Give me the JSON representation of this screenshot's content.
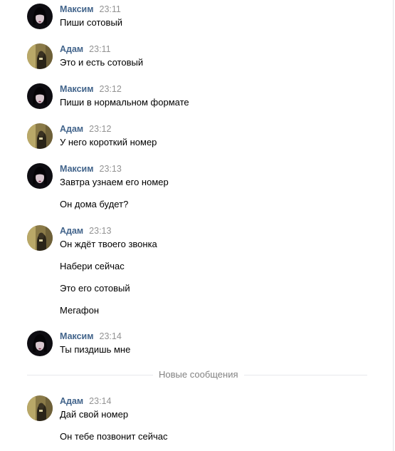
{
  "messages": [
    {
      "author": "Максим",
      "time": "23:11",
      "avatar": "maksim",
      "lines": [
        "Пиши сотовый"
      ]
    },
    {
      "author": "Адам",
      "time": "23:11",
      "avatar": "adam",
      "lines": [
        "Это и есть сотовый"
      ]
    },
    {
      "author": "Максим",
      "time": "23:12",
      "avatar": "maksim",
      "lines": [
        "Пиши в нормальном формате"
      ]
    },
    {
      "author": "Адам",
      "time": "23:12",
      "avatar": "adam",
      "lines": [
        "У него короткий номер"
      ]
    },
    {
      "author": "Максим",
      "time": "23:13",
      "avatar": "maksim",
      "lines": [
        "Завтра узнаем его номер",
        "Он дома будет?"
      ]
    },
    {
      "author": "Адам",
      "time": "23:13",
      "avatar": "adam",
      "lines": [
        "Он ждёт твоего звонка",
        "Набери сейчас",
        "Это его сотовый",
        "Мегафон"
      ]
    },
    {
      "author": "Максим",
      "time": "23:14",
      "avatar": "maksim",
      "lines": [
        "Ты пиздишь мне"
      ]
    },
    {
      "author": "Адам",
      "time": "23:14",
      "avatar": "adam",
      "lines": [
        "Дай свой номер",
        "Он тебе позвонит сейчас"
      ]
    }
  ],
  "divider": {
    "label": "Новые сообщения"
  },
  "colors": {
    "author": "#42648b",
    "time": "#939393",
    "divider": "#e7e8ec"
  }
}
